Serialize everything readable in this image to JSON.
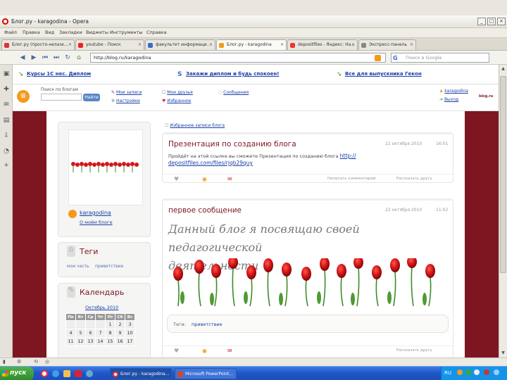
{
  "window": {
    "title": "Блог.ру - karagodina - Opera"
  },
  "menu": [
    "Файл",
    "Правка",
    "Вид",
    "Закладки",
    "Виджеты",
    "Инструменты",
    "Справка"
  ],
  "tabs": [
    {
      "label": "Блог.ру (просто-нелазк..."
    },
    {
      "label": "youtube - Поиск"
    },
    {
      "label": "факультет информаци..."
    },
    {
      "label": "Блог.ру - karagodina"
    },
    {
      "label": "depositfiles - Яндекс: На..."
    },
    {
      "label": "Экспресс-панель"
    }
  ],
  "address": {
    "url": "http://blog.ru/karagodina",
    "search_placeholder": "Поиск в Google"
  },
  "ads": [
    {
      "text": "Курсы 1С нес. Диплом"
    },
    {
      "text": "Закажи диплом и будь спокоен!"
    },
    {
      "text": "Все для выпускника Гекон"
    }
  ],
  "header": {
    "search_label": "Поиск по блогам",
    "search_button": "Найти",
    "links": [
      "Мои записи",
      "Настройки",
      "Мои друзья",
      "Избранное",
      "Сообщения"
    ],
    "user": "karagodina",
    "exit": "Выход"
  },
  "sidebar": {
    "username": "karagodina",
    "profile_link": "О моём блоге",
    "tags_title": "Теги",
    "tags": [
      "мои часть",
      "приветствие"
    ],
    "calendar_title": "Календарь",
    "calendar_month": "Октябрь 2010",
    "weekdays": [
      "Пн",
      "Вт",
      "Ср",
      "Чт",
      "Пт",
      "Сб",
      "Вс"
    ],
    "weeks": [
      [
        "",
        "",
        "",
        "",
        "1",
        "2",
        "3"
      ],
      [
        "4",
        "5",
        "6",
        "7",
        "8",
        "9",
        "10"
      ],
      [
        "11",
        "12",
        "13",
        "14",
        "15",
        "16",
        "17"
      ]
    ]
  },
  "top_link": "Избранное записи блога",
  "posts": [
    {
      "title": "Презентация по созданию блога",
      "date": "22 октября 2010",
      "time": "16:01",
      "body": "Пройдёт на этой ссылке вы сможете Презентация по созданию блога",
      "link": "http://depositfiles.com/files/rjqb29quy",
      "link_line1": "http://",
      "link_line2": "depositfiles.com/files/rjqb29quy",
      "comment": "Написать комментарий",
      "share": "Рассказать другу"
    },
    {
      "title": "первое сообщение",
      "date": "22 октября 2010",
      "time": "11:02",
      "handwriting": "Данный блог я посвящаю своей педагогической деятельности",
      "hand_line1": "Данный блог я посвящаю своей педагогической",
      "hand_line2": "деятельности",
      "tags_label": "Теги:",
      "tag": "приветствие",
      "share": "Рассказать другу"
    }
  ],
  "taskbar": {
    "start": "пуск",
    "buttons": [
      "Блог.ру - karagodina...",
      "Microsoft PowerPoint..."
    ],
    "lang": "RU"
  },
  "colors": {
    "accent": "#7e1622",
    "link": "#1a3fa8",
    "tulip": "#d5141a"
  }
}
